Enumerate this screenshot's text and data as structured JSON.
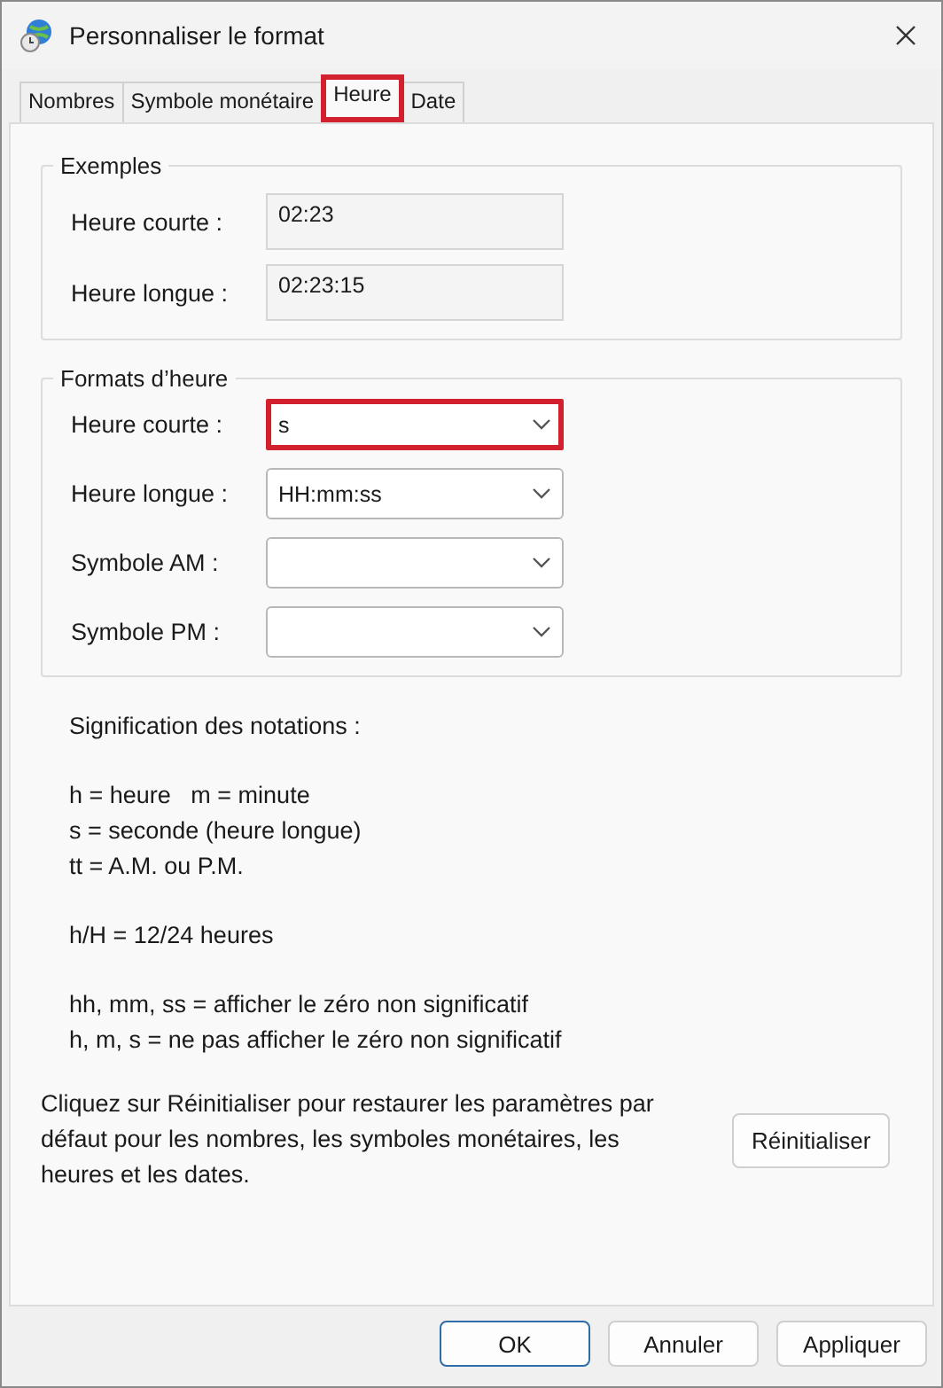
{
  "window": {
    "title": "Personnaliser le format"
  },
  "tabs": [
    {
      "label": "Nombres",
      "selected": false,
      "highlighted": false
    },
    {
      "label": "Symbole monétaire",
      "selected": false,
      "highlighted": false
    },
    {
      "label": "Heure",
      "selected": true,
      "highlighted": true
    },
    {
      "label": "Date",
      "selected": false,
      "highlighted": false
    }
  ],
  "examples": {
    "title": "Exemples",
    "rows": [
      {
        "label": "Heure courte :",
        "value": "02:23"
      },
      {
        "label": "Heure longue :",
        "value": "02:23:15"
      }
    ]
  },
  "formats": {
    "title": "Formats d’heure",
    "rows": [
      {
        "label": "Heure courte :",
        "value": "s",
        "highlighted": true
      },
      {
        "label": "Heure longue :",
        "value": "HH:mm:ss",
        "highlighted": false
      },
      {
        "label": "Symbole AM :",
        "highlighted": false
      },
      {
        "label": "Symbole PM :",
        "highlighted": false
      }
    ]
  },
  "notation": {
    "title": "Signification des notations :",
    "groups": [
      [
        "h = heure   m = minute",
        "s = seconde (heure longue)",
        "tt = A.M. ou P.M."
      ],
      [
        "h/H = 12/24 heures"
      ],
      [
        "hh, mm, ss = afficher le zéro non significatif",
        "h, m, s = ne pas afficher le zéro non significatif"
      ]
    ]
  },
  "reset": {
    "text": "Cliquez sur Réinitialiser pour restaurer les paramètres par défaut pour les nombres, les symboles monétaires, les heures et les dates.",
    "button": "Réinitialiser"
  },
  "buttons": [
    {
      "label": "OK",
      "kind": "default"
    },
    {
      "label": "Annuler",
      "kind": "normal"
    },
    {
      "label": "Appliquer",
      "kind": "normal"
    }
  ]
}
